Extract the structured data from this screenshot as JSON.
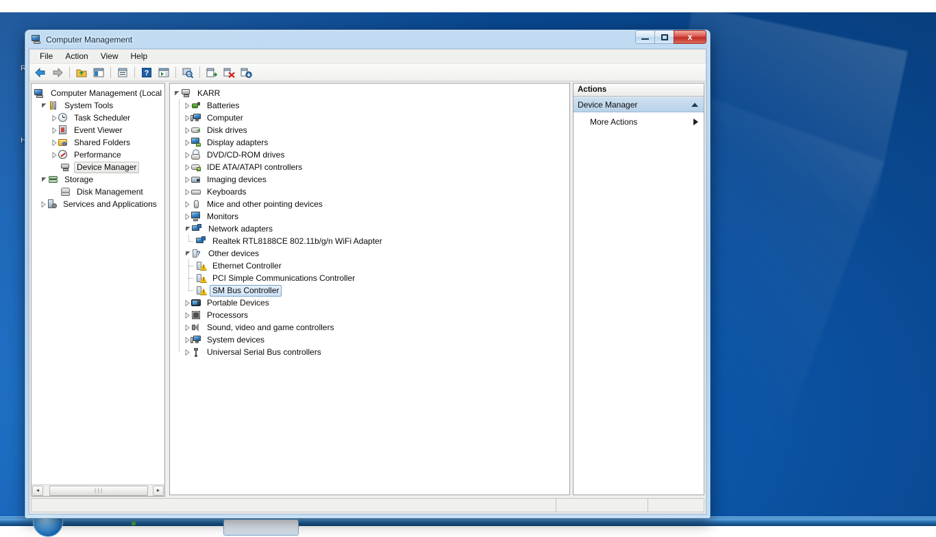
{
  "desktop": {
    "icon_labels": [
      "R",
      "H"
    ],
    "wallpaper_color": "#0d5cb4"
  },
  "window": {
    "title": "Computer Management",
    "title_icon": "computer-management-icon",
    "buttons": {
      "minimize": "minimize-icon",
      "maximize": "maximize-icon",
      "close": "x"
    }
  },
  "menu": {
    "items": [
      {
        "label": "File",
        "name": "menu-file"
      },
      {
        "label": "Action",
        "name": "menu-action"
      },
      {
        "label": "View",
        "name": "menu-view"
      },
      {
        "label": "Help",
        "name": "menu-help"
      }
    ]
  },
  "toolbar": {
    "buttons": [
      {
        "name": "back-button",
        "icon": "back-arrow-icon"
      },
      {
        "name": "forward-button",
        "icon": "forward-arrow-icon"
      },
      {
        "name": "up-one-level-button",
        "icon": "folder-up-icon"
      },
      {
        "name": "show-hide-console-tree-button",
        "icon": "console-tree-icon"
      },
      {
        "name": "properties-button",
        "icon": "properties-icon"
      },
      {
        "name": "help-button",
        "icon": "question-mark-icon"
      },
      {
        "name": "show-hide-action-pane-button",
        "icon": "action-pane-icon"
      },
      {
        "name": "scan-for-hardware-changes-button",
        "icon": "scan-hardware-icon"
      },
      {
        "name": "update-driver-button",
        "icon": "update-driver-icon"
      },
      {
        "name": "disable-device-button",
        "icon": "disable-device-icon"
      },
      {
        "name": "uninstall-device-button",
        "icon": "uninstall-device-icon"
      }
    ]
  },
  "console_tree": {
    "items": [
      {
        "label": "Computer Management (Local",
        "icon": "computer-management-icon",
        "depth": 0,
        "expander": "none",
        "state": "normal"
      },
      {
        "label": "System Tools",
        "icon": "system-tools-icon",
        "depth": 1,
        "expander": "expanded",
        "state": "normal"
      },
      {
        "label": "Task Scheduler",
        "icon": "clock-icon",
        "depth": 2,
        "expander": "collapsed",
        "state": "normal"
      },
      {
        "label": "Event Viewer",
        "icon": "event-viewer-icon",
        "depth": 2,
        "expander": "collapsed",
        "state": "normal"
      },
      {
        "label": "Shared Folders",
        "icon": "shared-folders-icon",
        "depth": 2,
        "expander": "collapsed",
        "state": "normal"
      },
      {
        "label": "Performance",
        "icon": "performance-icon",
        "depth": 2,
        "expander": "collapsed",
        "state": "normal"
      },
      {
        "label": "Device Manager",
        "icon": "device-manager-icon",
        "depth": 2,
        "expander": "none",
        "state": "selected-inactive"
      },
      {
        "label": "Storage",
        "icon": "storage-icon",
        "depth": 1,
        "expander": "expanded",
        "state": "normal"
      },
      {
        "label": "Disk Management",
        "icon": "disk-management-icon",
        "depth": 2,
        "expander": "none",
        "state": "normal"
      },
      {
        "label": "Services and Applications",
        "icon": "services-applications-icon",
        "depth": 1,
        "expander": "collapsed",
        "state": "normal"
      }
    ],
    "hscrollbar": {
      "left_arrow": "◄",
      "right_arrow": "►",
      "grip": "∣∣∣"
    }
  },
  "device_tree": {
    "items": [
      {
        "label": "KARR",
        "icon": "computer-icon",
        "depth": 0,
        "expander": "expanded",
        "state": "normal"
      },
      {
        "label": "Batteries",
        "icon": "battery-icon",
        "depth": 1,
        "expander": "collapsed",
        "state": "normal"
      },
      {
        "label": "Computer",
        "icon": "computer-screen-icon",
        "depth": 1,
        "expander": "collapsed",
        "state": "normal"
      },
      {
        "label": "Disk drives",
        "icon": "disk-drive-icon",
        "depth": 1,
        "expander": "collapsed",
        "state": "normal"
      },
      {
        "label": "Display adapters",
        "icon": "display-adapter-icon",
        "depth": 1,
        "expander": "collapsed",
        "state": "normal"
      },
      {
        "label": "DVD/CD-ROM drives",
        "icon": "dvd-drive-icon",
        "depth": 1,
        "expander": "collapsed",
        "state": "normal"
      },
      {
        "label": "IDE ATA/ATAPI controllers",
        "icon": "ide-controller-icon",
        "depth": 1,
        "expander": "collapsed",
        "state": "normal"
      },
      {
        "label": "Imaging devices",
        "icon": "imaging-device-icon",
        "depth": 1,
        "expander": "collapsed",
        "state": "normal"
      },
      {
        "label": "Keyboards",
        "icon": "keyboard-icon",
        "depth": 1,
        "expander": "collapsed",
        "state": "normal"
      },
      {
        "label": "Mice and other pointing devices",
        "icon": "mouse-icon",
        "depth": 1,
        "expander": "collapsed",
        "state": "normal"
      },
      {
        "label": "Monitors",
        "icon": "monitor-icon",
        "depth": 1,
        "expander": "collapsed",
        "state": "normal"
      },
      {
        "label": "Network adapters",
        "icon": "network-adapter-icon",
        "depth": 1,
        "expander": "expanded",
        "state": "normal"
      },
      {
        "label": "Realtek RTL8188CE 802.11b/g/n WiFi Adapter",
        "icon": "network-adapter-icon",
        "depth": 2,
        "expander": "none",
        "state": "normal"
      },
      {
        "label": "Other devices",
        "icon": "unknown-device-icon",
        "depth": 1,
        "expander": "expanded",
        "state": "normal"
      },
      {
        "label": "Ethernet Controller",
        "icon": "warning-device-icon",
        "depth": 2,
        "expander": "none",
        "state": "normal"
      },
      {
        "label": "PCI Simple Communications Controller",
        "icon": "warning-device-icon",
        "depth": 2,
        "expander": "none",
        "state": "normal"
      },
      {
        "label": "SM Bus Controller",
        "icon": "warning-device-icon",
        "depth": 2,
        "expander": "none",
        "state": "selected-active"
      },
      {
        "label": "Portable Devices",
        "icon": "portable-device-icon",
        "depth": 1,
        "expander": "collapsed",
        "state": "normal"
      },
      {
        "label": "Processors",
        "icon": "processor-icon",
        "depth": 1,
        "expander": "collapsed",
        "state": "normal"
      },
      {
        "label": "Sound, video and game controllers",
        "icon": "sound-controller-icon",
        "depth": 1,
        "expander": "collapsed",
        "state": "normal"
      },
      {
        "label": "System devices",
        "icon": "system-device-icon",
        "depth": 1,
        "expander": "collapsed",
        "state": "normal"
      },
      {
        "label": "Universal Serial Bus controllers",
        "icon": "usb-controller-icon",
        "depth": 1,
        "expander": "collapsed",
        "state": "normal"
      }
    ]
  },
  "actions_pane": {
    "header": "Actions",
    "section_label": "Device Manager",
    "section_collapse_icon": "chevron-up-icon",
    "more_actions_label": "More Actions",
    "more_actions_icon": "chevron-right-icon"
  },
  "status_bar": {
    "segments": [
      "",
      "",
      ""
    ]
  }
}
